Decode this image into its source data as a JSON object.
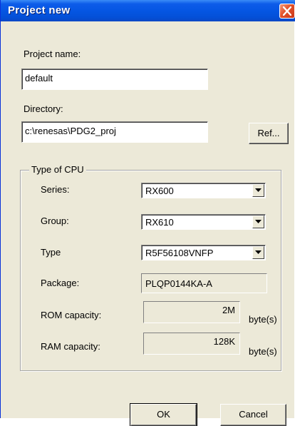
{
  "window": {
    "title": "Project new",
    "close_icon": "close-icon",
    "accent": "#0556e3",
    "close_color": "#e2522a"
  },
  "project": {
    "name_label": "Project name:",
    "name_value": "default",
    "directory_label": "Directory:",
    "directory_value": "c:\\renesas\\PDG2_proj",
    "ref_button": "Ref..."
  },
  "cpu": {
    "group_label": "Type of CPU",
    "series_label": "Series:",
    "series_value": "RX600",
    "group_field_label": "Group:",
    "group_value": "RX610",
    "type_label": "Type",
    "type_value": "R5F56108VNFP",
    "package_label": "Package:",
    "package_value": "PLQP0144KA-A",
    "rom_label": "ROM capacity:",
    "rom_value": "2M",
    "rom_unit": "byte(s)",
    "ram_label": "RAM capacity:",
    "ram_value": "128K",
    "ram_unit": "byte(s)"
  },
  "buttons": {
    "ok": "OK",
    "cancel": "Cancel"
  }
}
